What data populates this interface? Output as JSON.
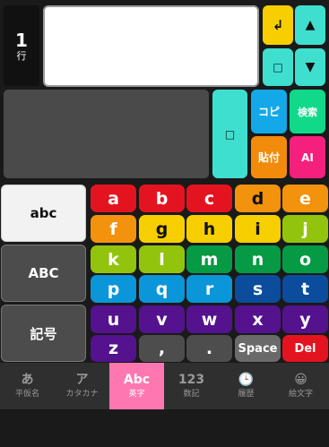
{
  "line": {
    "number": "1",
    "label": "行"
  },
  "editor": {
    "text": ""
  },
  "top_buttons": {
    "enter": "↲",
    "up": "▲",
    "square": "□",
    "down": "▼"
  },
  "tool_buttons": {
    "square": "□",
    "copy": "コピ",
    "search": "検索",
    "paste": "貼付",
    "ai": "AI"
  },
  "modes": {
    "lower": "abc",
    "upper": "ABC",
    "symbols": "記号"
  },
  "keys": [
    "a",
    "b",
    "c",
    "d",
    "e",
    "f",
    "g",
    "h",
    "i",
    "j",
    "k",
    "l",
    "m",
    "n",
    "o",
    "p",
    "q",
    "r",
    "s",
    "t",
    "u",
    "v",
    "w",
    "x",
    "y",
    "z",
    ",",
    ".",
    "Space",
    "Del"
  ],
  "tabs": [
    {
      "icon": "あ",
      "label": "平仮名"
    },
    {
      "icon": "ア",
      "label": "カタカナ"
    },
    {
      "icon": "Abc",
      "label": "英字"
    },
    {
      "icon": "123",
      "label": "数記"
    },
    {
      "icon": "🕒",
      "label": "履歴"
    },
    {
      "icon": "😀",
      "label": "絵文字"
    }
  ],
  "colors": {
    "red": "#e3141f",
    "orange": "#f2920d",
    "yellow": "#f7cf00",
    "lime": "#92c40d",
    "green": "#079a45",
    "sky": "#0a96d8",
    "blue": "#0b4c9c",
    "purple": "#54128f",
    "grey": "#555555",
    "teal": "#3fdfd0",
    "tab_active": "#ff77b0"
  }
}
